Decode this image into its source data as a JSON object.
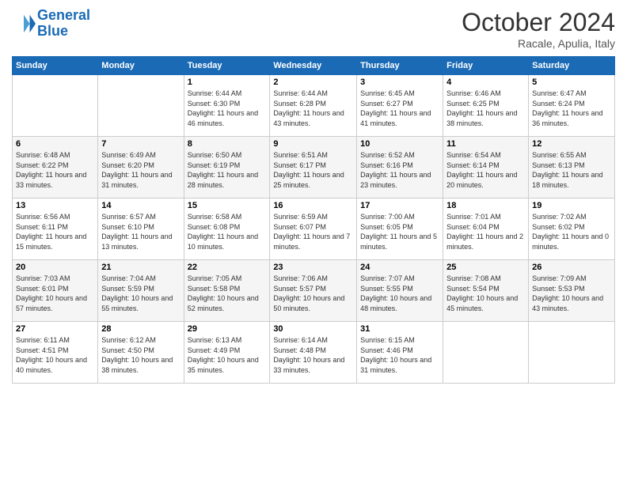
{
  "header": {
    "logo_line1": "General",
    "logo_line2": "Blue",
    "month": "October 2024",
    "location": "Racale, Apulia, Italy"
  },
  "days_of_week": [
    "Sunday",
    "Monday",
    "Tuesday",
    "Wednesday",
    "Thursday",
    "Friday",
    "Saturday"
  ],
  "weeks": [
    [
      {
        "day": "",
        "info": ""
      },
      {
        "day": "",
        "info": ""
      },
      {
        "day": "1",
        "info": "Sunrise: 6:44 AM\nSunset: 6:30 PM\nDaylight: 11 hours and 46 minutes."
      },
      {
        "day": "2",
        "info": "Sunrise: 6:44 AM\nSunset: 6:28 PM\nDaylight: 11 hours and 43 minutes."
      },
      {
        "day": "3",
        "info": "Sunrise: 6:45 AM\nSunset: 6:27 PM\nDaylight: 11 hours and 41 minutes."
      },
      {
        "day": "4",
        "info": "Sunrise: 6:46 AM\nSunset: 6:25 PM\nDaylight: 11 hours and 38 minutes."
      },
      {
        "day": "5",
        "info": "Sunrise: 6:47 AM\nSunset: 6:24 PM\nDaylight: 11 hours and 36 minutes."
      }
    ],
    [
      {
        "day": "6",
        "info": "Sunrise: 6:48 AM\nSunset: 6:22 PM\nDaylight: 11 hours and 33 minutes."
      },
      {
        "day": "7",
        "info": "Sunrise: 6:49 AM\nSunset: 6:20 PM\nDaylight: 11 hours and 31 minutes."
      },
      {
        "day": "8",
        "info": "Sunrise: 6:50 AM\nSunset: 6:19 PM\nDaylight: 11 hours and 28 minutes."
      },
      {
        "day": "9",
        "info": "Sunrise: 6:51 AM\nSunset: 6:17 PM\nDaylight: 11 hours and 25 minutes."
      },
      {
        "day": "10",
        "info": "Sunrise: 6:52 AM\nSunset: 6:16 PM\nDaylight: 11 hours and 23 minutes."
      },
      {
        "day": "11",
        "info": "Sunrise: 6:54 AM\nSunset: 6:14 PM\nDaylight: 11 hours and 20 minutes."
      },
      {
        "day": "12",
        "info": "Sunrise: 6:55 AM\nSunset: 6:13 PM\nDaylight: 11 hours and 18 minutes."
      }
    ],
    [
      {
        "day": "13",
        "info": "Sunrise: 6:56 AM\nSunset: 6:11 PM\nDaylight: 11 hours and 15 minutes."
      },
      {
        "day": "14",
        "info": "Sunrise: 6:57 AM\nSunset: 6:10 PM\nDaylight: 11 hours and 13 minutes."
      },
      {
        "day": "15",
        "info": "Sunrise: 6:58 AM\nSunset: 6:08 PM\nDaylight: 11 hours and 10 minutes."
      },
      {
        "day": "16",
        "info": "Sunrise: 6:59 AM\nSunset: 6:07 PM\nDaylight: 11 hours and 7 minutes."
      },
      {
        "day": "17",
        "info": "Sunrise: 7:00 AM\nSunset: 6:05 PM\nDaylight: 11 hours and 5 minutes."
      },
      {
        "day": "18",
        "info": "Sunrise: 7:01 AM\nSunset: 6:04 PM\nDaylight: 11 hours and 2 minutes."
      },
      {
        "day": "19",
        "info": "Sunrise: 7:02 AM\nSunset: 6:02 PM\nDaylight: 11 hours and 0 minutes."
      }
    ],
    [
      {
        "day": "20",
        "info": "Sunrise: 7:03 AM\nSunset: 6:01 PM\nDaylight: 10 hours and 57 minutes."
      },
      {
        "day": "21",
        "info": "Sunrise: 7:04 AM\nSunset: 5:59 PM\nDaylight: 10 hours and 55 minutes."
      },
      {
        "day": "22",
        "info": "Sunrise: 7:05 AM\nSunset: 5:58 PM\nDaylight: 10 hours and 52 minutes."
      },
      {
        "day": "23",
        "info": "Sunrise: 7:06 AM\nSunset: 5:57 PM\nDaylight: 10 hours and 50 minutes."
      },
      {
        "day": "24",
        "info": "Sunrise: 7:07 AM\nSunset: 5:55 PM\nDaylight: 10 hours and 48 minutes."
      },
      {
        "day": "25",
        "info": "Sunrise: 7:08 AM\nSunset: 5:54 PM\nDaylight: 10 hours and 45 minutes."
      },
      {
        "day": "26",
        "info": "Sunrise: 7:09 AM\nSunset: 5:53 PM\nDaylight: 10 hours and 43 minutes."
      }
    ],
    [
      {
        "day": "27",
        "info": "Sunrise: 6:11 AM\nSunset: 4:51 PM\nDaylight: 10 hours and 40 minutes."
      },
      {
        "day": "28",
        "info": "Sunrise: 6:12 AM\nSunset: 4:50 PM\nDaylight: 10 hours and 38 minutes."
      },
      {
        "day": "29",
        "info": "Sunrise: 6:13 AM\nSunset: 4:49 PM\nDaylight: 10 hours and 35 minutes."
      },
      {
        "day": "30",
        "info": "Sunrise: 6:14 AM\nSunset: 4:48 PM\nDaylight: 10 hours and 33 minutes."
      },
      {
        "day": "31",
        "info": "Sunrise: 6:15 AM\nSunset: 4:46 PM\nDaylight: 10 hours and 31 minutes."
      },
      {
        "day": "",
        "info": ""
      },
      {
        "day": "",
        "info": ""
      }
    ]
  ]
}
